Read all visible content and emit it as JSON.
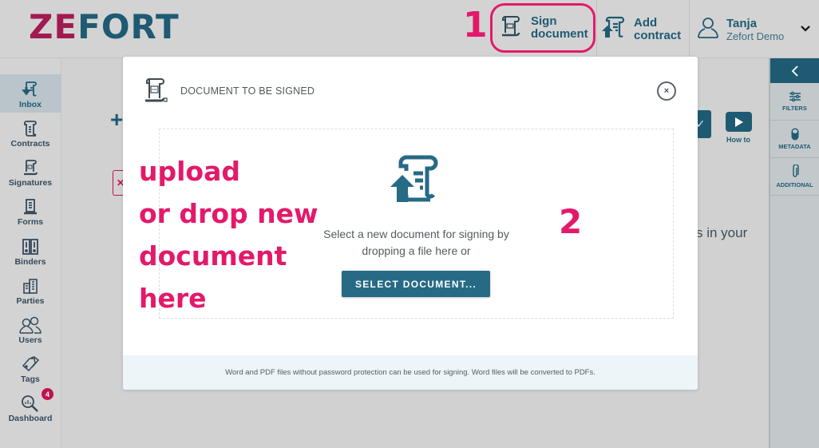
{
  "app": {
    "logo_part1": "ZE",
    "logo_part2": "FORT",
    "brand_colors": {
      "primary": "#1f5a73",
      "accent": "#a21a52",
      "annotation": "#e3196a"
    }
  },
  "header": {
    "step_marker": "1",
    "sign_document": {
      "line1": "Sign",
      "line2": "document",
      "icon": "sign-document-icon"
    },
    "add_contract": {
      "line1": "Add",
      "line2": "contract",
      "icon": "add-contract-icon"
    },
    "user": {
      "name": "Tanja",
      "organization": "Zefort Demo",
      "icon": "user-icon"
    }
  },
  "sidebar": {
    "items": [
      {
        "label": "Inbox",
        "icon": "inbox-icon",
        "active": true
      },
      {
        "label": "Contracts",
        "icon": "contracts-icon"
      },
      {
        "label": "Signatures",
        "icon": "signatures-icon"
      },
      {
        "label": "Forms",
        "icon": "forms-icon"
      },
      {
        "label": "Binders",
        "icon": "binders-icon"
      },
      {
        "label": "Parties",
        "icon": "parties-icon"
      },
      {
        "label": "Users",
        "icon": "users-icon"
      },
      {
        "label": "Tags",
        "icon": "tags-icon"
      },
      {
        "label": "Dashboard",
        "icon": "dashboard-icon",
        "badge": "4"
      }
    ]
  },
  "background": {
    "plus": "+",
    "close_x": "✕",
    "check": "✓",
    "how_to": "How to",
    "partial_text": "s in your"
  },
  "rightbar": {
    "items": [
      {
        "label": "FILTERS",
        "icon": "filters-icon"
      },
      {
        "label": "METADATA",
        "icon": "metadata-icon"
      },
      {
        "label": "ADDITIONAL",
        "icon": "paperclip-icon"
      }
    ]
  },
  "modal": {
    "title": "DOCUMENT TO BE SIGNED",
    "close": "×",
    "dropzone_line1": "Select a new document for signing by",
    "dropzone_line2": "dropping a file here or",
    "select_button": "SELECT DOCUMENT...",
    "footer": "Word and PDF files without password protection can be used for signing. Word files will be converted to PDFs."
  },
  "annotations": {
    "instruction_lines": [
      "upload",
      "or drop new",
      "document",
      "here"
    ],
    "step_marker_2": "2"
  }
}
